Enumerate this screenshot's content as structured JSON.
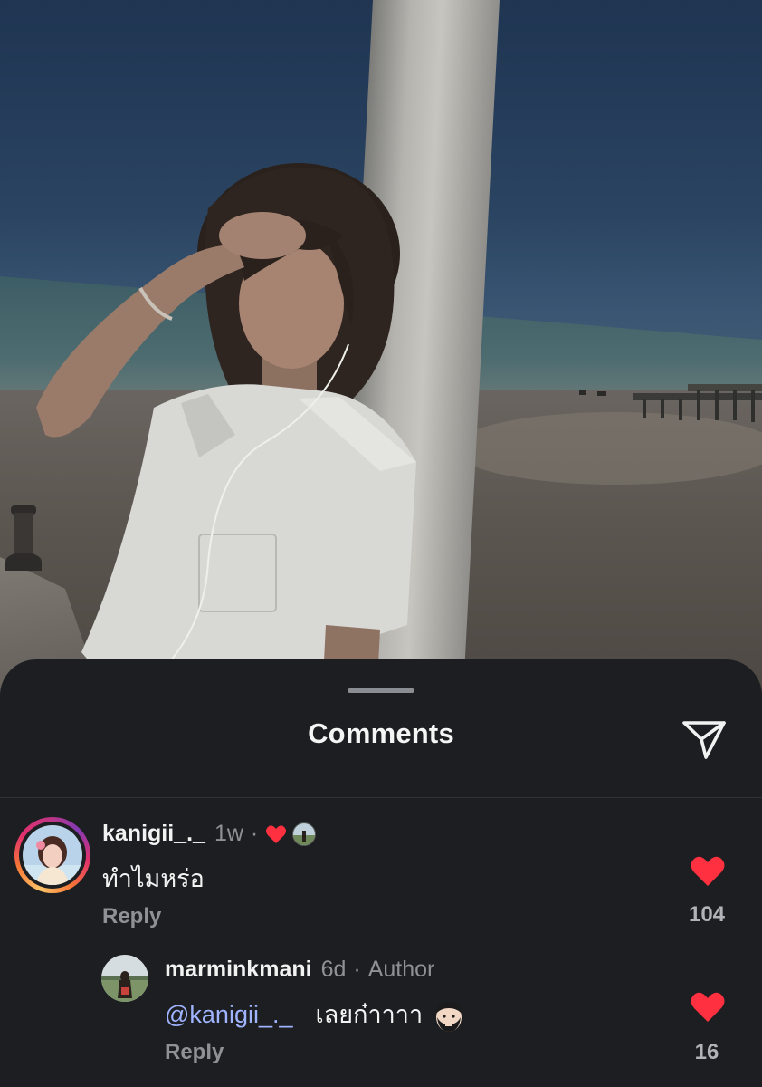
{
  "sheet": {
    "title": "Comments"
  },
  "comments": [
    {
      "username": "kanigii_._",
      "time": "1w",
      "separator": "·",
      "text": "ทำไมหร่อ",
      "reply_label": "Reply",
      "likes": "104",
      "liked": true
    },
    {
      "username": "marminkmani",
      "time": "6d",
      "separator": "·",
      "author_tag": "Author",
      "mention": "@kanigii_._",
      "text": "เลยก๋าาาา",
      "reply_label": "Reply",
      "likes": "16",
      "liked": true
    }
  ],
  "colors": {
    "sheet_background": "#1c1e21",
    "like_red": "#ff3040",
    "mention_blue": "#9fb3ff",
    "muted_text": "#8e9196"
  },
  "icons": {
    "share": "paper-plane-icon",
    "like": "heart-icon"
  }
}
